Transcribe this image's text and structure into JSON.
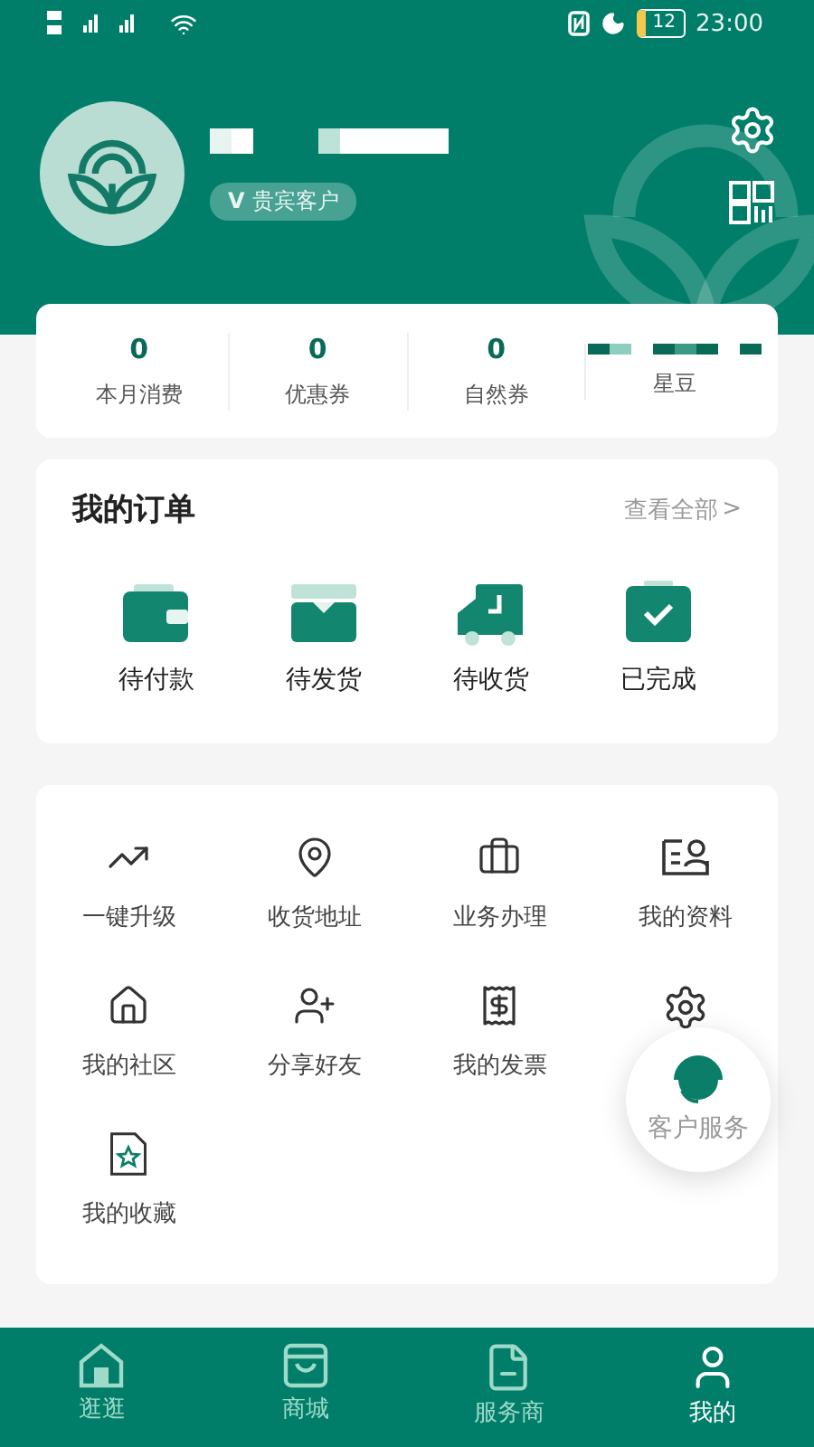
{
  "status_bar": {
    "battery": "12",
    "time": "23:00"
  },
  "profile": {
    "vip_mark": "V",
    "badge": "贵宾客户"
  },
  "stats": [
    {
      "value": "0",
      "label": "本月消费"
    },
    {
      "value": "0",
      "label": "优惠券"
    },
    {
      "value": "0",
      "label": "自然券"
    },
    {
      "label": "星豆"
    }
  ],
  "orders": {
    "title": "我的订单",
    "view_all": "查看全部",
    "chevron": ">",
    "items": [
      "待付款",
      "待发货",
      "待收货",
      "已完成"
    ]
  },
  "services": [
    {
      "label": "一键升级"
    },
    {
      "label": "收货地址"
    },
    {
      "label": "业务办理"
    },
    {
      "label": "我的资料"
    },
    {
      "label": "我的社区"
    },
    {
      "label": "分享好友"
    },
    {
      "label": "我的发票"
    },
    {
      "label": "我的收藏"
    }
  ],
  "floating_button": {
    "label": "客户服务"
  },
  "tabs": [
    {
      "label": "逛逛",
      "selected": false
    },
    {
      "label": "商城",
      "selected": false
    },
    {
      "label": "服务商",
      "selected": false
    },
    {
      "label": "我的",
      "selected": true
    }
  ]
}
